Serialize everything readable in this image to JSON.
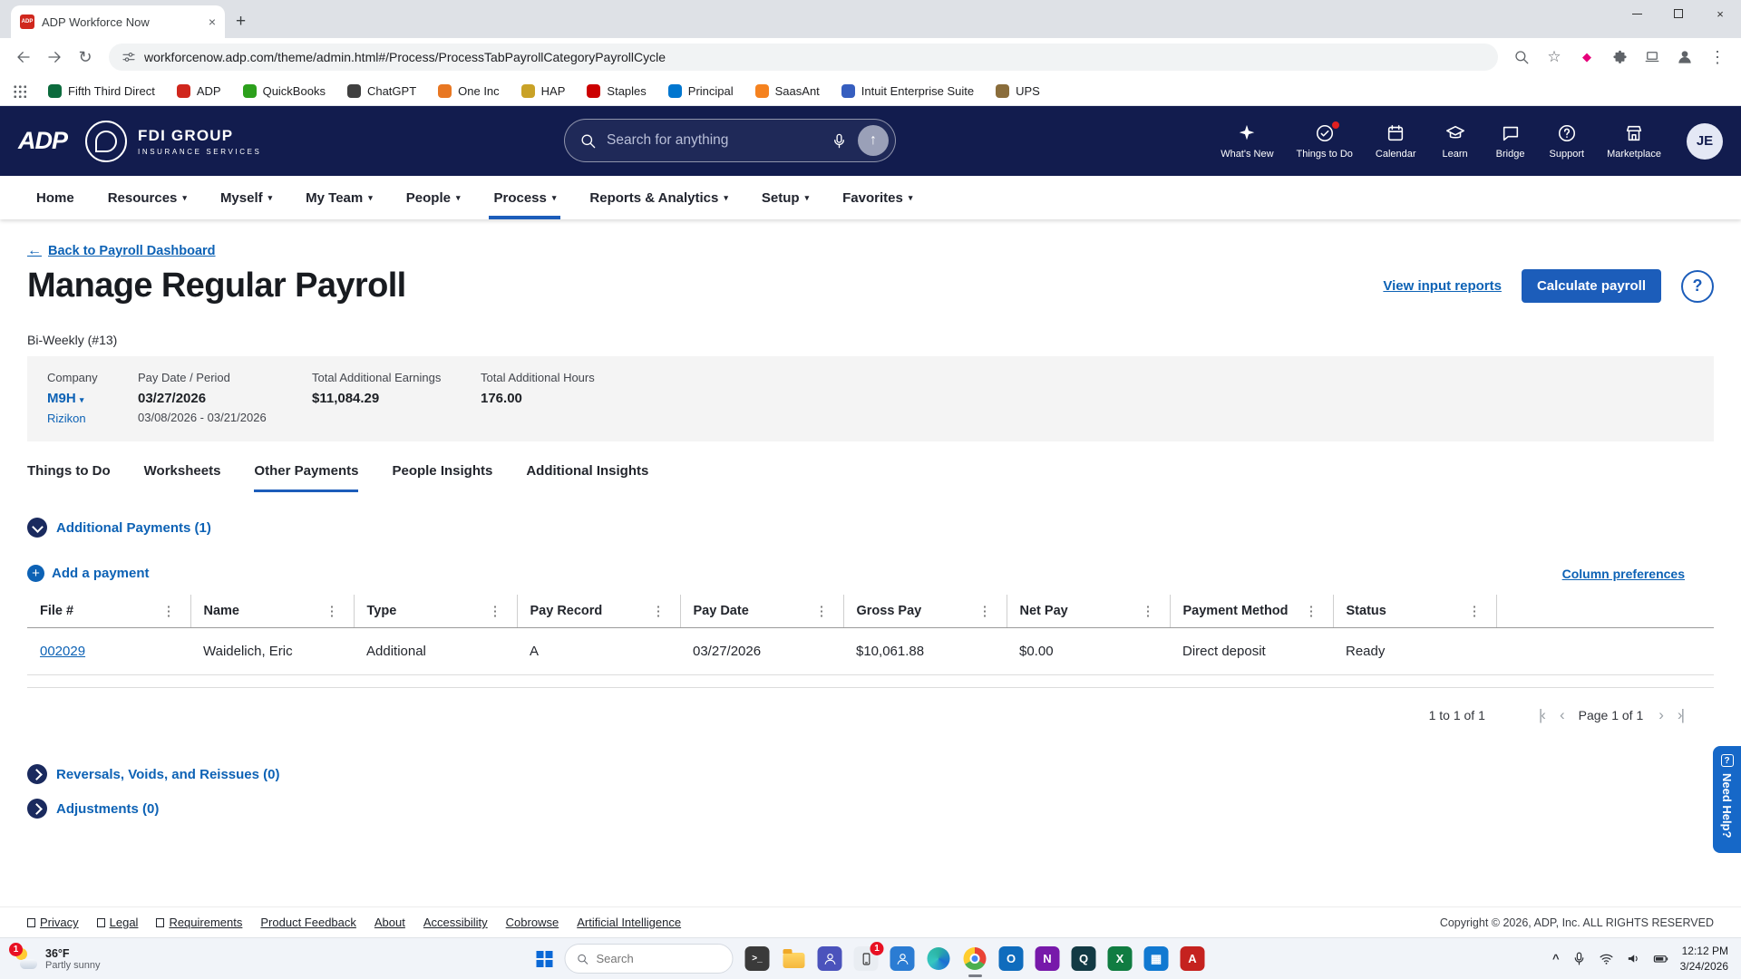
{
  "browser": {
    "tab_title": "ADP Workforce Now",
    "url": "workforcenow.adp.com/theme/admin.html#/Process/ProcessTabPayrollCategoryPayrollCycle",
    "bookmarks": [
      {
        "label": "Fifth Third Direct",
        "color": "#0c6b3d"
      },
      {
        "label": "ADP",
        "color": "#d0271d"
      },
      {
        "label": "QuickBooks",
        "color": "#2ca01c"
      },
      {
        "label": "ChatGPT",
        "color": "#404040"
      },
      {
        "label": "One Inc",
        "color": "#e87722"
      },
      {
        "label": "HAP",
        "color": "#c9a227"
      },
      {
        "label": "Staples",
        "color": "#cc0000"
      },
      {
        "label": "Principal",
        "color": "#0076cf"
      },
      {
        "label": "SaasAnt",
        "color": "#f5821f"
      },
      {
        "label": "Intuit Enterprise Suite",
        "color": "#365ebf"
      },
      {
        "label": "UPS",
        "color": "#8a6d3b"
      }
    ]
  },
  "header": {
    "logo": "ADP",
    "brand": "FDI GROUP",
    "brand_sub": "INSURANCE SERVICES",
    "search_placeholder": "Search for anything",
    "icons": [
      {
        "label": "What's New"
      },
      {
        "label": "Things to Do"
      },
      {
        "label": "Calendar"
      },
      {
        "label": "Learn"
      },
      {
        "label": "Bridge"
      },
      {
        "label": "Support"
      },
      {
        "label": "Marketplace"
      }
    ],
    "avatar": "JE"
  },
  "nav": {
    "items": [
      {
        "label": "Home"
      },
      {
        "label": "Resources"
      },
      {
        "label": "Myself"
      },
      {
        "label": "My Team"
      },
      {
        "label": "People"
      },
      {
        "label": "Process"
      },
      {
        "label": "Reports & Analytics"
      },
      {
        "label": "Setup"
      },
      {
        "label": "Favorites"
      }
    ]
  },
  "page": {
    "back_link": "Back to Payroll Dashboard",
    "title": "Manage Regular Payroll",
    "actions": {
      "view_input_reports": "View input reports",
      "calculate_payroll": "Calculate payroll"
    },
    "cycle_label": "Bi-Weekly (#13)",
    "summary": {
      "company_label": "Company",
      "company_value": "M9H",
      "company_sub": "Rizikon",
      "pay_date_label": "Pay Date / Period",
      "pay_date": "03/27/2026",
      "pay_period": "03/08/2026 - 03/21/2026",
      "earnings_label": "Total Additional Earnings",
      "earnings_value": "$11,084.29",
      "hours_label": "Total Additional Hours",
      "hours_value": "176.00"
    },
    "tabs": [
      "Things to Do",
      "Worksheets",
      "Other Payments",
      "People Insights",
      "Additional Insights"
    ],
    "sections": {
      "additional_payments": "Additional Payments (1)",
      "add_payment": "Add a payment",
      "column_preferences": "Column preferences",
      "reversals": "Reversals, Voids, and Reissues (0)",
      "adjustments": "Adjustments (0)"
    },
    "table": {
      "columns": [
        "File #",
        "Name",
        "Type",
        "Pay Record",
        "Pay Date",
        "Gross Pay",
        "Net Pay",
        "Payment Method",
        "Status"
      ],
      "rows": [
        {
          "file": "002029",
          "name": "Waidelich, Eric",
          "type": "Additional",
          "pay_record": "A",
          "pay_date": "03/27/2026",
          "gross_pay": "$10,061.88",
          "net_pay": "$0.00",
          "payment_method": "Direct deposit",
          "status": "Ready"
        }
      ]
    },
    "pagination": {
      "range": "1 to 1 of 1",
      "page": "Page 1 of 1"
    },
    "need_help": "Need Help?"
  },
  "footer": {
    "links": [
      "Privacy",
      "Legal",
      "Requirements",
      "Product Feedback",
      "About",
      "Accessibility",
      "Cobrowse",
      "Artificial Intelligence"
    ],
    "copyright": "Copyright © 2026, ADP, Inc. ALL RIGHTS RESERVED"
  },
  "taskbar": {
    "weather": {
      "temp": "36°F",
      "condition": "Partly sunny",
      "badge": "1"
    },
    "search_placeholder": "Search",
    "phone_badge": "1",
    "clock": {
      "time": "12:12 PM",
      "date": "3/24/2026"
    }
  },
  "theme": {
    "header_bg": "#121c4e",
    "accent_blue": "#0d62b5",
    "button_blue": "#1c5dba",
    "need_help_blue": "#1668c8",
    "status_red": "#e02020"
  }
}
